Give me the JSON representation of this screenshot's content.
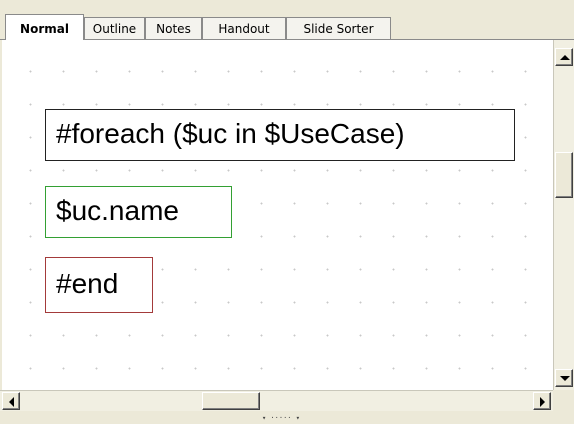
{
  "tabs": [
    {
      "label": "Normal",
      "active": true
    },
    {
      "label": "Outline",
      "active": false
    },
    {
      "label": "Notes",
      "active": false
    },
    {
      "label": "Handout",
      "active": false
    },
    {
      "label": "Slide Sorter",
      "active": false
    }
  ],
  "slide": {
    "foreach_text": "#foreach ($uc in $UseCase)",
    "name_text": "$uc.name",
    "end_text": "#end"
  },
  "colors": {
    "foreach_border": "#222222",
    "name_border": "#33a033",
    "end_border": "#a33a3a"
  },
  "icons": {
    "scroll_up": "arrow-up-icon",
    "scroll_down": "arrow-down-icon",
    "scroll_left": "arrow-left-icon",
    "scroll_right": "arrow-right-icon",
    "splitter": "splitter-grip-icon"
  },
  "splitter_grip": "▾ ····· ▾"
}
